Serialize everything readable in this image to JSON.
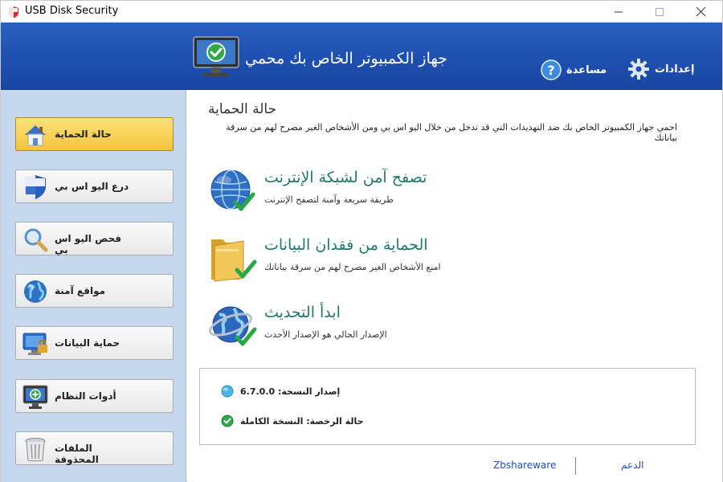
{
  "app": {
    "title": "USB Disk Security"
  },
  "header": {
    "title": "جهاز الكمبيوتر الخاص بك محمي",
    "help_label": "مساعدة",
    "settings_label": "إعدادات"
  },
  "sidebar": {
    "items": [
      {
        "label": "حالة الحماية",
        "icon": "house-icon",
        "active": true
      },
      {
        "label": "درع اليو اس بي",
        "icon": "shield-icon",
        "active": false
      },
      {
        "label": "فحص اليو اس بي",
        "icon": "magnifier-icon",
        "active": false
      },
      {
        "label": "مواقع آمنة",
        "icon": "globe-icon",
        "active": false
      },
      {
        "label": "حماية البيانات",
        "icon": "monitor-lock-icon",
        "active": false
      },
      {
        "label": "أدوات النظام",
        "icon": "monitor-plus-icon",
        "active": false
      },
      {
        "label": "الملفات المحذوفة",
        "icon": "trash-icon",
        "active": false
      }
    ]
  },
  "main": {
    "title": "حالة الحماية",
    "description": "احمي جهاز الكمبيوتر الخاص بك ضد التهديدات التي قد تدخل من خلال اليو اس بي ومن الأشخاص الغير مصرح لهم من سرقة بياناتك",
    "features": [
      {
        "title": "تصفح آمن لشبكة الإنترنت",
        "subtitle": "طريقة سريعة وآمنة لتصفح الإنترنت",
        "icon": "globe-check-icon"
      },
      {
        "title": "الحماية من فقدان البيانات",
        "subtitle": "امنع الأشخاص الغير مصرح لهم من سرقة بياناتك",
        "icon": "folder-check-icon"
      },
      {
        "title": "ابدأ التحديث",
        "subtitle": "الإصدار الحالي هو الإصدار الأحدث",
        "icon": "globe-update-icon"
      }
    ],
    "info": {
      "version": "إصدار النسخة: 6.7.0.0",
      "license": "حالة الرخصة: النسخة الكاملة"
    }
  },
  "footer": {
    "left_link": "Zbshareware",
    "right_link": "الدعم"
  },
  "colors": {
    "header_blue": "#1e4fb0",
    "sidebar_bg": "#c5d8ee",
    "active_item": "#f5c43d",
    "feature_title": "#1f7a6e",
    "link": "#1a52b8"
  }
}
